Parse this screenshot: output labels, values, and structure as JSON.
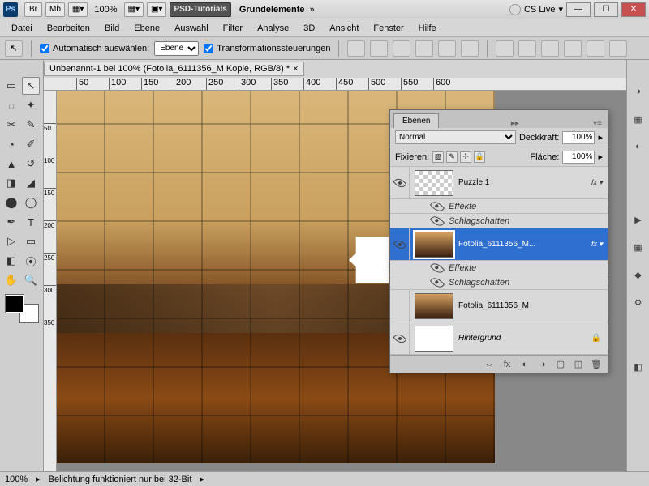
{
  "titlebar": {
    "br_label": "Br",
    "mb_label": "Mb",
    "zoom_value": "100%",
    "tutorial_btn": "PSD-Tutorials",
    "grundelemente": "Grundelemente",
    "cslive": "CS Live"
  },
  "menus": [
    "Datei",
    "Bearbeiten",
    "Bild",
    "Ebene",
    "Auswahl",
    "Filter",
    "Analyse",
    "3D",
    "Ansicht",
    "Fenster",
    "Hilfe"
  ],
  "options": {
    "auto_select_label": "Automatisch auswählen:",
    "auto_select_target": "Ebene",
    "transform_controls_label": "Transformationssteuerungen"
  },
  "document": {
    "tab_title": "Unbenannt-1 bei 100% (Fotolia_6111356_M Kopie, RGB/8) *",
    "ruler_h": [
      "50",
      "100",
      "150",
      "200",
      "250",
      "300",
      "350",
      "400",
      "450",
      "500",
      "550",
      "600"
    ],
    "ruler_v": [
      "50",
      "100",
      "150",
      "200",
      "250",
      "300",
      "350"
    ]
  },
  "layers_panel": {
    "tab_label": "Ebenen",
    "blend_mode": "Normal",
    "opacity_label": "Deckkraft:",
    "opacity_value": "100%",
    "lock_label": "Fixieren:",
    "fill_label": "Fläche:",
    "fill_value": "100%",
    "layers": {
      "puzzle": "Puzzle 1",
      "effects_label": "Effekte",
      "dropshadow": "Schlagschatten",
      "selected": "Fotolia_6111356_M...",
      "base_copy": "Fotolia_6111356_M",
      "background": "Hintergrund"
    }
  },
  "statusbar": {
    "zoom": "100%",
    "info": "Belichtung funktioniert nur bei 32-Bit"
  },
  "tool_glyphs": [
    "▭",
    "↖",
    "◌",
    "✦",
    "✂",
    "✎",
    "◔",
    "✐",
    "◢",
    "T",
    "▷",
    "▭",
    "◧",
    "✋",
    "🔍"
  ]
}
